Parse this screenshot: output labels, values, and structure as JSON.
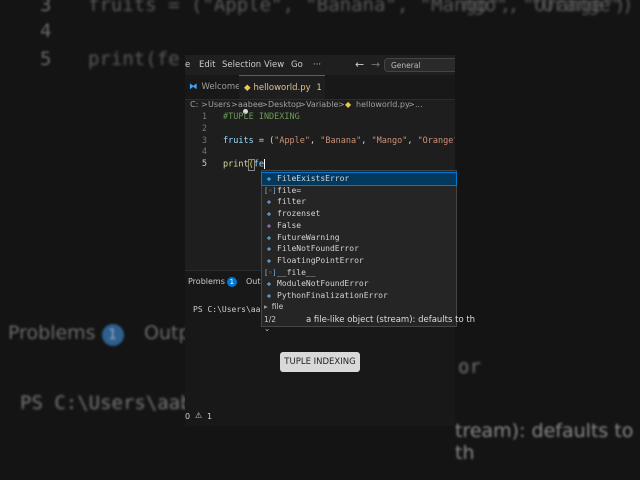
{
  "background": {
    "top_line": "fruits = (\"Apple\", \"Banana\", \"Mango\", \"Orange\")",
    "line_num_3": "3",
    "line_num_4": "4",
    "line_num_5": "5",
    "line_5_code": "print(fe",
    "problems_label": "Problems",
    "problems_count": "1",
    "output_label": "Outp",
    "terminal_prompt": "PS C:\\Users\\aab",
    "right_fragment_1": "ngo\", \"Orange\")",
    "right_fragment_2": "or",
    "right_fragment_3": "tream): defaults to th"
  },
  "menu": {
    "items": [
      "e",
      "Edit",
      "Selection",
      "View",
      "Go",
      "···"
    ],
    "back_icon": "arrow-left-icon",
    "forward_icon": "arrow-right-icon",
    "search_text": "General Knowledge"
  },
  "tabs": {
    "welcome": "Welcome",
    "active_file": "helloworld.py",
    "active_badge": "1"
  },
  "breadcrumb": {
    "parts": [
      "C:",
      "Users",
      "aabee",
      "Desktop",
      "Variable",
      "helloworld.py",
      "..."
    ],
    "separator": ">"
  },
  "editor": {
    "line_numbers": [
      "1",
      "2",
      "3",
      "4",
      "5"
    ],
    "line1": "#TUPLE INDEXING",
    "line3_var": "fruits",
    "line3_op": " = (",
    "line3_s1": "\"Apple\"",
    "line3_s2": "\"Banana\"",
    "line3_s3": "\"Mango\"",
    "line3_s4": "\"Orange\"",
    "comma": ", ",
    "close": ")",
    "line5_fn": "print",
    "line5_paren": "(",
    "line5_arg": "fe"
  },
  "suggestions": {
    "items": [
      {
        "label": "FileExistsError",
        "kind": "class"
      },
      {
        "label": "file=",
        "kind": "param"
      },
      {
        "label": "filter",
        "kind": "class"
      },
      {
        "label": "frozenset",
        "kind": "class"
      },
      {
        "label": "False",
        "kind": "keyword"
      },
      {
        "label": "FutureWarning",
        "kind": "class"
      },
      {
        "label": "FileNotFoundError",
        "kind": "class"
      },
      {
        "label": "FloatingPointError",
        "kind": "class"
      },
      {
        "label": "__file__",
        "kind": "param"
      },
      {
        "label": "ModuleNotFoundError",
        "kind": "class"
      },
      {
        "label": "PythonFinalizationError",
        "kind": "class"
      }
    ],
    "hint": "file",
    "count": "1/2",
    "doc": "a file-like object (stream): defaults to th"
  },
  "panel": {
    "problems_label": "Problems",
    "problems_count": "1",
    "output_label": "Outp",
    "terminal_line": "PS C:\\Users\\aab",
    "caption": "TUPLE INDEXING"
  },
  "status": {
    "errors": "0",
    "warnings": "1"
  }
}
